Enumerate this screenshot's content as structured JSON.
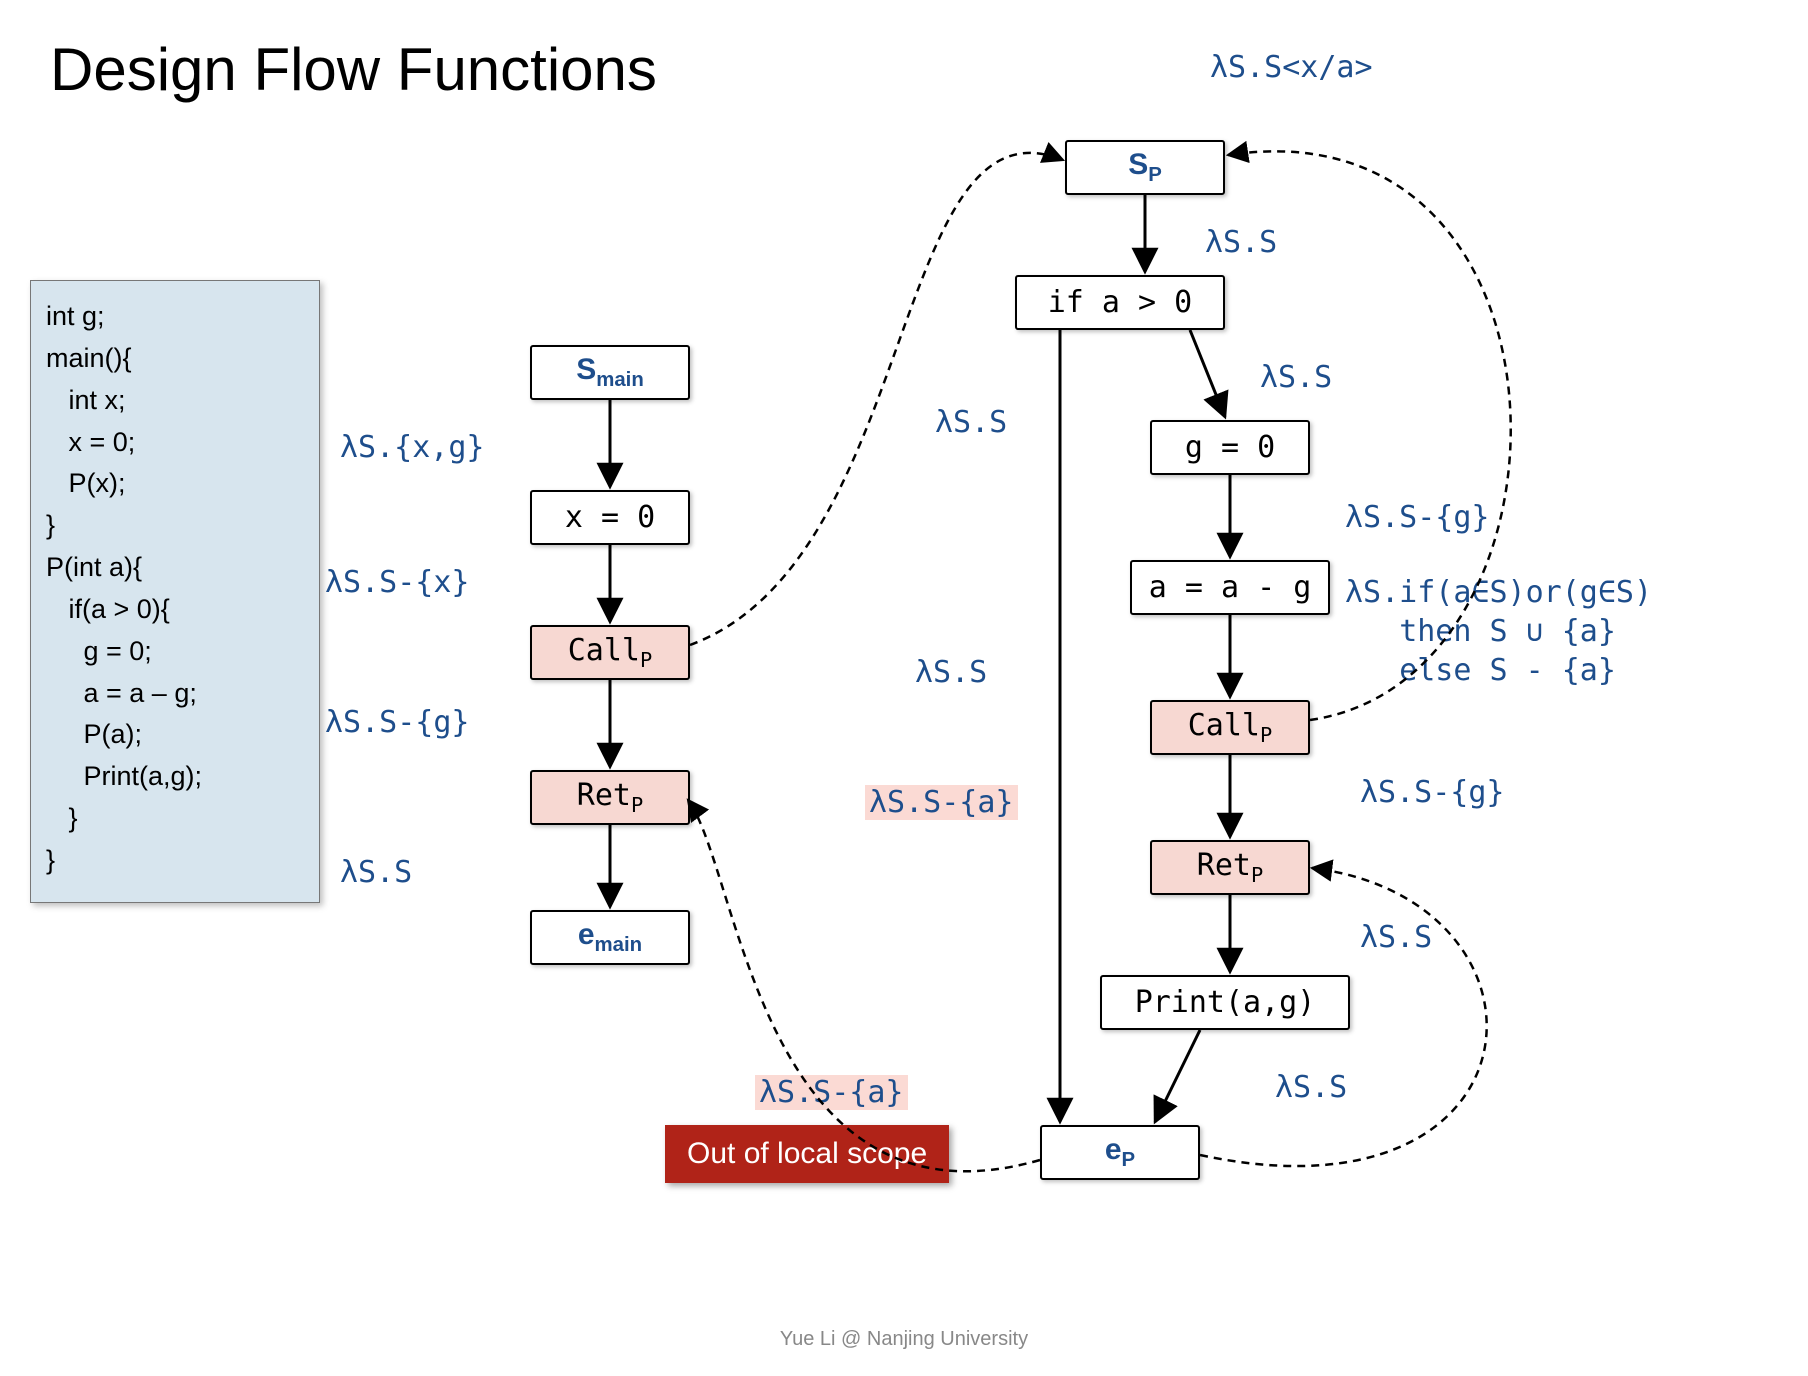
{
  "title": "Design Flow Functions",
  "code": "int g;\nmain(){\n   int x;\n   x = 0;\n   P(x);\n}\nP(int a){\n   if(a > 0){\n     g = 0;\n     a = a – g;\n     P(a);\n     Print(a,g);\n   }\n}",
  "nodes": {
    "s_main_pre": "S",
    "s_main_sub": "main",
    "x0": "x = 0",
    "call_p1": "Call",
    "call_p1_sub": "P",
    "ret_p1": "Ret",
    "ret_p1_sub": "P",
    "e_main_pre": "e",
    "e_main_sub": "main",
    "s_p_pre": "S",
    "s_p_sub": "P",
    "if_a": "if a > 0",
    "g0": "g = 0",
    "aag": "a = a - g",
    "call_p2": "Call",
    "call_p2_sub": "P",
    "ret_p2": "Ret",
    "ret_p2_sub": "P",
    "print": "Print(a,g)",
    "e_p_pre": "e",
    "e_p_sub": "P"
  },
  "labels": {
    "top_right": "λS.S<x/a>",
    "l1": "λS.{x,g}",
    "l2": "λS.S-{x}",
    "l3": "λS.S-{g}",
    "l4": "λS.S",
    "l5": "λS.S",
    "l6": "λS.S",
    "l7": "λS.S",
    "l8": "λS.S-{g}",
    "l9a": "λS.if(a∈S)or(g∈S)",
    "l9b": "then S ∪ {a}",
    "l9c": "else S - {a}",
    "l10": "λS.S",
    "l11": "λS.S-{g}",
    "l12": "λS.S",
    "l13": "λS.S",
    "l14": "λS.S-{a}",
    "l15": "λS.S-{a}"
  },
  "callout": "Out of local scope",
  "footer": "Yue Li @ Nanjing University"
}
